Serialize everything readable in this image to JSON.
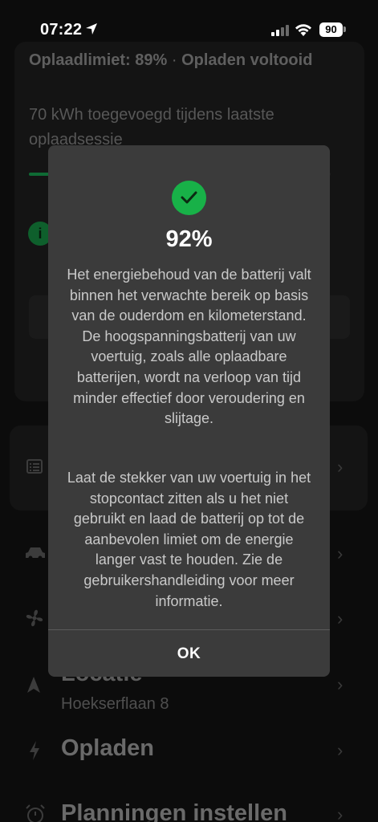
{
  "status_bar": {
    "time": "07:22",
    "battery_level": "90"
  },
  "background": {
    "summary_limit": "Oplaadlimiet: 89%",
    "summary_separator": "·",
    "summary_status": "Opladen voltooid",
    "session_text": "70 kWh toegevoegd tijdens laatste oplaadsessie",
    "info_icon_glyph": "i",
    "location_title": "Locatie",
    "location_address": "Hoekserflaan 8",
    "charging_title": "Opladen",
    "schedule_title": "Planningen instellen"
  },
  "modal": {
    "percent": "92%",
    "paragraph_1": "Het energiebehoud van de batterij valt binnen het verwachte bereik op basis van de ouderdom en kilometerstand. De hoogspanningsbatterij van uw voertuig, zoals alle oplaadbare batterijen, wordt na verloop van tijd minder effectief door veroudering en slijtage.",
    "paragraph_2": "Laat de stekker van uw voertuig in het stopcontact zitten als u het niet gebruikt en laad de batterij op tot de aanbevolen limiet om de energie langer vast te houden. Zie de gebruikershandleiding voor meer informatie.",
    "ok_label": "OK"
  },
  "colors": {
    "accent_green": "#18b148",
    "modal_bg": "#3b3b3b"
  },
  "icons": [
    "location-arrow-icon",
    "signal-icon",
    "wifi-icon",
    "battery-icon",
    "checkmark-icon",
    "info-icon",
    "list-icon",
    "car-icon",
    "fan-icon",
    "navigation-icon",
    "bolt-icon",
    "alarm-clock-icon",
    "chevron-right-icon"
  ]
}
